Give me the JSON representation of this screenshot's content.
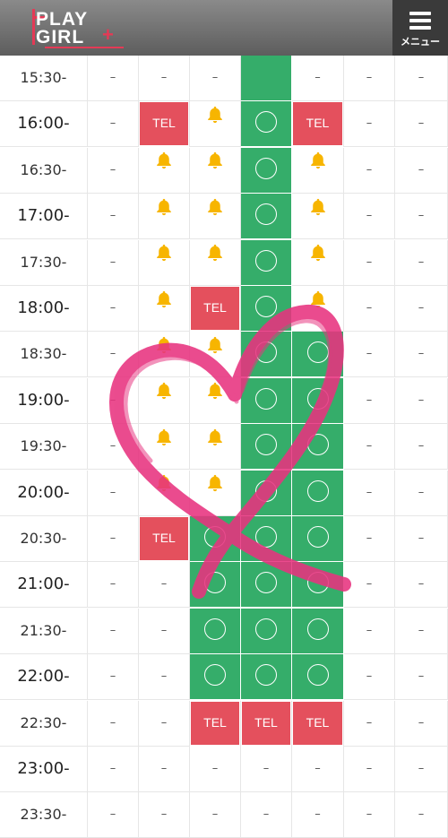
{
  "header": {
    "logo_line1": "PLAY",
    "logo_line2": "GIRL",
    "logo_plus": "+",
    "menu_label": "メニュー",
    "menu_icon": "hamburger-icon"
  },
  "colors": {
    "available": "#35ad6a",
    "tel": "#e4505d",
    "bell": "#f7b500",
    "header": "#6b6b6b"
  },
  "symbols": {
    "dash": "–",
    "tel": "TEL",
    "bell_icon": "bell-icon",
    "circle_icon": "circle-icon"
  },
  "schedule": [
    {
      "time": "15:30-",
      "cells": [
        "dash",
        "dash",
        "dash",
        "green",
        "dash",
        "dash",
        "dash"
      ]
    },
    {
      "time": "16:00-",
      "cells": [
        "dash",
        "tel",
        "bell",
        "circle",
        "tel",
        "dash",
        "dash"
      ]
    },
    {
      "time": "16:30-",
      "cells": [
        "dash",
        "bell",
        "bell",
        "circle",
        "bell",
        "dash",
        "dash"
      ]
    },
    {
      "time": "17:00-",
      "cells": [
        "dash",
        "bell",
        "bell",
        "circle",
        "bell",
        "dash",
        "dash"
      ]
    },
    {
      "time": "17:30-",
      "cells": [
        "dash",
        "bell",
        "bell",
        "circle",
        "bell",
        "dash",
        "dash"
      ]
    },
    {
      "time": "18:00-",
      "cells": [
        "dash",
        "bell",
        "tel",
        "circle",
        "bell",
        "dash",
        "dash"
      ]
    },
    {
      "time": "18:30-",
      "cells": [
        "dash",
        "bell",
        "bell",
        "circle",
        "circle",
        "dash",
        "dash"
      ]
    },
    {
      "time": "19:00-",
      "cells": [
        "dash",
        "bell",
        "bell",
        "circle",
        "circle",
        "dash",
        "dash"
      ]
    },
    {
      "time": "19:30-",
      "cells": [
        "dash",
        "bell",
        "bell",
        "circle",
        "circle",
        "dash",
        "dash"
      ]
    },
    {
      "time": "20:00-",
      "cells": [
        "dash",
        "bell",
        "bell",
        "circle",
        "circle",
        "dash",
        "dash"
      ]
    },
    {
      "time": "20:30-",
      "cells": [
        "dash",
        "tel",
        "circle",
        "circle",
        "circle",
        "dash",
        "dash"
      ]
    },
    {
      "time": "21:00-",
      "cells": [
        "dash",
        "dash",
        "circle",
        "circle",
        "circle",
        "dash",
        "dash"
      ]
    },
    {
      "time": "21:30-",
      "cells": [
        "dash",
        "dash",
        "circle",
        "circle",
        "circle",
        "dash",
        "dash"
      ]
    },
    {
      "time": "22:00-",
      "cells": [
        "dash",
        "dash",
        "circle",
        "circle",
        "circle",
        "dash",
        "dash"
      ]
    },
    {
      "time": "22:30-",
      "cells": [
        "dash",
        "dash",
        "tel",
        "tel",
        "tel",
        "dash",
        "dash"
      ]
    },
    {
      "time": "23:00-",
      "cells": [
        "dash",
        "dash",
        "dash",
        "dash",
        "dash",
        "dash",
        "dash"
      ]
    },
    {
      "time": "23:30-",
      "cells": [
        "dash",
        "dash",
        "dash",
        "dash",
        "dash",
        "dash",
        "dash"
      ]
    }
  ],
  "overlay": {
    "heart_icon": "heart-scribble-icon",
    "color": "#e8337f"
  }
}
